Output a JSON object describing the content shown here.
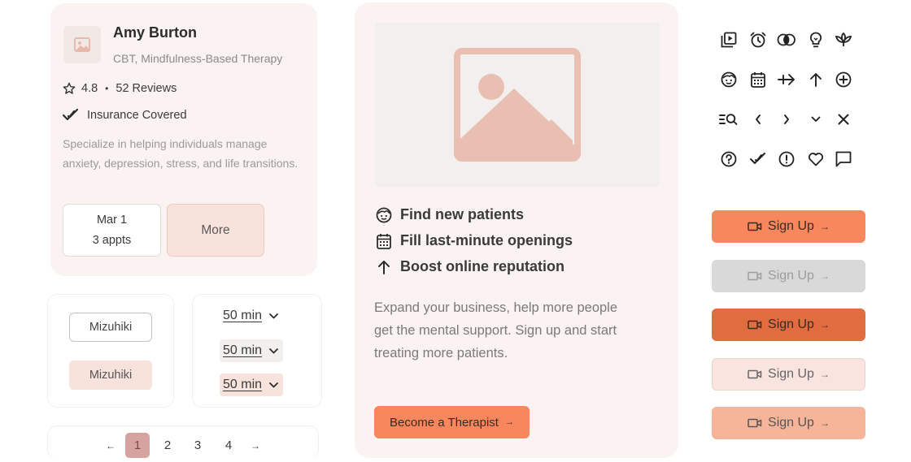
{
  "colors": {
    "accent": "#f8875d",
    "accent_dark": "#e06c40",
    "accent_soft": "#f8e2dc",
    "card_bg": "#faf3f1",
    "disabled": "#d9d9d9",
    "page_active": "#d6a3a1"
  },
  "therapist": {
    "name": "Amy Burton",
    "specialty": "CBT, Mindfulness-Based Therapy",
    "rating": "4.8",
    "separator": "•",
    "reviews": "52 Reviews",
    "insurance": "Insurance Covered",
    "bio": "Specialize in helping individuals manage anxiety, depression, stress, and life transitions.",
    "date": "Mar 1",
    "appointments": "3 appts",
    "more_label": "More",
    "avatar_icon": "image-placeholder-icon",
    "rating_icon": "star-icon",
    "insurance_icon": "double-check-icon"
  },
  "chips": {
    "outline_label": "Mizuhiki",
    "filled_label": "Mizuhiki"
  },
  "durations": [
    {
      "label": "50 min",
      "icon": "chevron-down-icon"
    },
    {
      "label": "50 min",
      "icon": "chevron-down-icon"
    },
    {
      "label": "50 min",
      "icon": "chevron-down-icon"
    }
  ],
  "pagination": {
    "prev": "←",
    "pages": [
      "1",
      "2",
      "3",
      "4"
    ],
    "current": "1",
    "next": "→"
  },
  "promo": {
    "image_icon": "image-placeholder-icon",
    "features": [
      {
        "icon": "face-icon",
        "label": "Find new patients"
      },
      {
        "icon": "calendar-icon",
        "label": "Fill last-minute openings"
      },
      {
        "icon": "arrow-up-icon",
        "label": "Boost online reputation"
      }
    ],
    "text": "Expand your business, help more people get the mental support. Sign up and start treating more patients.",
    "cta_label": "Become a Therapist",
    "cta_arrow": "→"
  },
  "icon_grid": [
    [
      "play-square-icon",
      "alarm-clock-icon",
      "two-circles-icon",
      "lightbulb-icon",
      "lotus-icon"
    ],
    [
      "face-icon",
      "calendar-icon",
      "arrow-right-bar-icon",
      "arrow-up-icon",
      "plus-circle-icon"
    ],
    [
      "search-list-icon",
      "chevron-left-icon",
      "chevron-right-icon",
      "chevron-down-icon",
      "close-icon"
    ],
    [
      "help-circle-icon",
      "double-check-icon",
      "alert-circle-icon",
      "heart-icon",
      "chat-square-icon"
    ]
  ],
  "signup_buttons": [
    {
      "label": "Sign Up",
      "state": "default",
      "icon": "video-icon",
      "arrow": "→"
    },
    {
      "label": "Sign Up",
      "state": "disabled",
      "icon": "video-icon",
      "arrow": "→"
    },
    {
      "label": "Sign Up",
      "state": "pressed",
      "icon": "video-icon",
      "arrow": "→"
    },
    {
      "label": "Sign Up",
      "state": "soft",
      "icon": "video-icon",
      "arrow": "→"
    },
    {
      "label": "Sign Up",
      "state": "hover",
      "icon": "video-icon",
      "arrow": "→"
    }
  ]
}
